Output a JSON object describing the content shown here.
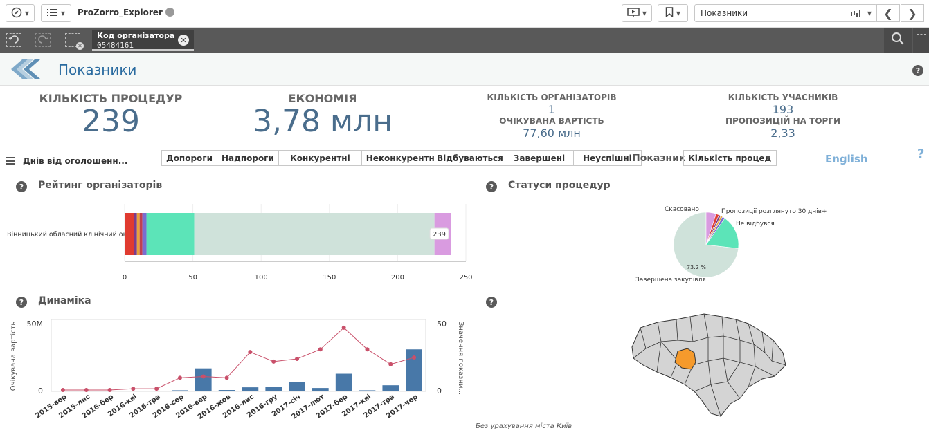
{
  "toolbar": {
    "app_name": "ProZorro_Explorer",
    "sheet_name": "Показники",
    "icons": [
      "compass-icon",
      "list-icon",
      "presentation-icon",
      "bookmark-icon",
      "sheet-grid-icon",
      "arrow-left-icon",
      "arrow-right-icon"
    ]
  },
  "selection": {
    "field": "Код організатора",
    "value": "05484161"
  },
  "header": {
    "title": "Показники"
  },
  "kpis": {
    "procedures_label": "КІЛЬКІСТЬ ПРОЦЕДУР",
    "procedures_value": "239",
    "savings_label": "ЕКОНОМІЯ",
    "savings_value": "3,78 млн",
    "organizers_label": "КІЛЬКІСТЬ ОРГАНІЗАТОРІВ",
    "organizers_value": "1",
    "expected_label": "ОЧІКУВАНА ВАРТІСТЬ",
    "expected_value": "77,60 млн",
    "participants_label": "КІЛЬКІСТЬ УЧАСНИКІВ",
    "participants_value": "193",
    "proposals_label": "ПРОПОЗИЦІЙ НА ТОРГИ",
    "proposals_value": "2,33"
  },
  "filters": {
    "days_label": "Днів від оголошенн...",
    "threshold": [
      "Допороги",
      "Надпороги"
    ],
    "competition": [
      "Конкурентні",
      "Неконкурентні"
    ],
    "status": [
      "Відбуваються",
      "Завершені",
      "Неуспішні"
    ],
    "indicator_label": "Показник",
    "indicator_value": "Кількість процед",
    "language": "English",
    "help": "?"
  },
  "ranking": {
    "title": "Рейтинг організаторів",
    "row_label": "Вінницький обласний клінічний он...",
    "total_label": "239",
    "xticks": [
      "0",
      "50",
      "100",
      "150",
      "200",
      "250"
    ]
  },
  "statuses": {
    "title": "Статуси процедур",
    "labels": [
      "Скасовано",
      "Пропозиції розглянуто 30 днів+",
      "Не відбувся",
      "Завершена закупівля"
    ],
    "percent": "73.2 %"
  },
  "dynamics": {
    "title": "Динаміка",
    "left_axis": "Очікувана вартість",
    "right_axis": "Значення показни...",
    "left_ticks": [
      "50M",
      "0"
    ],
    "right_ticks": [
      "50",
      "0"
    ],
    "months": [
      "2015-вер",
      "2015-лис",
      "2016-бер",
      "2016-кві",
      "2016-тра",
      "2016-сер",
      "2016-вер",
      "2016-жов",
      "2016-лис",
      "2016-гру",
      "2017-січ",
      "2017-лют",
      "2017-бер",
      "2017-кві",
      "2017-тра",
      "2017-чер"
    ]
  },
  "footnote": "Без урахування міста Київ",
  "chart_data": [
    {
      "type": "bar",
      "title": "Рейтинг організаторів",
      "categories": [
        "Вінницький обласний клінічний он..."
      ],
      "series": [
        {
          "values": [
            7
          ]
        },
        {
          "values": [
            2
          ]
        },
        {
          "values": [
            2
          ]
        },
        {
          "values": [
            2
          ]
        },
        {
          "values": [
            3
          ]
        },
        {
          "values": [
            35
          ]
        },
        {
          "values": [
            176
          ]
        },
        {
          "values": [
            12
          ]
        }
      ],
      "colors": [
        "#e03b30",
        "#7b3d8c",
        "#e8a33a",
        "#c04050",
        "#7a6ed0",
        "#5ce4b8",
        "#cfe2da",
        "#d99be0"
      ],
      "total": 239,
      "xlim": [
        0,
        250
      ],
      "orientation": "horizontal"
    },
    {
      "type": "pie",
      "title": "Статуси процедур",
      "slices": [
        {
          "label": "Завершена закупівля",
          "value": 73.2,
          "color": "#cfe2da"
        },
        {
          "label": "Скасовано",
          "value": 5.0,
          "color": "#d99be0"
        },
        {
          "label": "",
          "value": 1.5,
          "color": "#e03b30"
        },
        {
          "label": "",
          "value": 1.0,
          "color": "#7b3d8c"
        },
        {
          "label": "",
          "value": 1.0,
          "color": "#e8a33a"
        },
        {
          "label": "Пропозиції розглянуто 30 днів+",
          "value": 1.3,
          "color": "#7a6ed0"
        },
        {
          "label": "Не відбувся",
          "value": 17.0,
          "color": "#5ce4b8"
        }
      ]
    },
    {
      "type": "bar",
      "title": "Динаміка",
      "categories": [
        "2015-вер",
        "2015-лис",
        "2016-бер",
        "2016-кві",
        "2016-тра",
        "2016-сер",
        "2016-вер",
        "2016-жов",
        "2016-лис",
        "2016-гру",
        "2017-січ",
        "2017-лют",
        "2017-бер",
        "2017-кві",
        "2017-тра",
        "2017-чер"
      ],
      "series": [
        {
          "name": "Очікувана вартість",
          "type": "bar",
          "axis": "left",
          "values": [
            0,
            0,
            0,
            0.2,
            0.3,
            0.8,
            17,
            1.0,
            3,
            3.5,
            7,
            2.5,
            13,
            0.8,
            4.5,
            31
          ]
        },
        {
          "name": "Значення показни...",
          "type": "line",
          "axis": "right",
          "values": [
            1,
            1,
            1,
            2,
            2,
            10,
            11,
            10,
            29,
            22,
            24,
            31,
            47,
            31,
            20,
            25
          ]
        }
      ],
      "ylim_left": [
        0,
        50000000
      ],
      "ylim_right": [
        0,
        50
      ],
      "colors": {
        "bar": "#4878a8",
        "line": "#c9506a"
      }
    }
  ]
}
